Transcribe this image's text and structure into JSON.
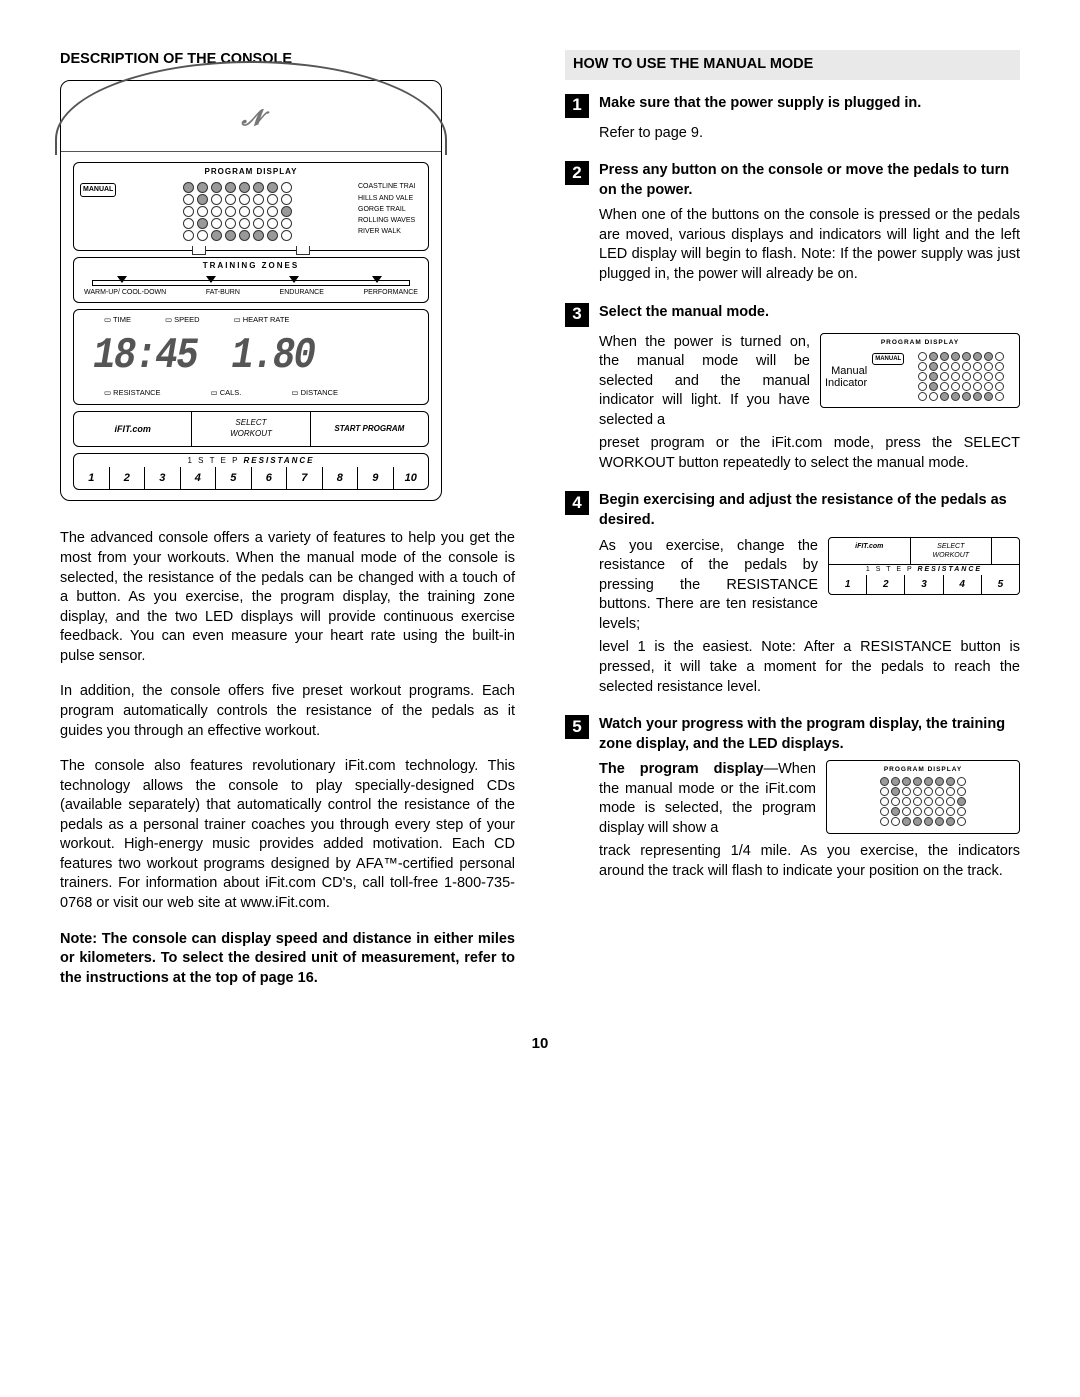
{
  "page_number": "10",
  "left": {
    "header": "DESCRIPTION OF THE CONSOLE",
    "console": {
      "program_display_label": "PROGRAM DISPLAY",
      "manual_label": "MANUAL",
      "courses": [
        "COASTLINE TRAI",
        "HILLS AND VALE",
        "GORGE TRAIL",
        "ROLLING WAVES",
        "RIVER WALK"
      ],
      "training_zones_label": "TRAINING ZONES",
      "tz_items": [
        "WARM-UP/ COOL-DOWN",
        "FAT-BURN",
        "ENDURANCE",
        "PERFORMANCE"
      ],
      "lcd_top": [
        "TIME",
        "SPEED",
        "HEART RATE"
      ],
      "lcd_left_value": "18:45",
      "lcd_right_value": "1.80",
      "lcd_bot": [
        "RESISTANCE",
        "CALS.",
        "DISTANCE"
      ],
      "buttons": {
        "ifit": "iFIT.com",
        "select1": "SELECT",
        "select2": "WORKOUT",
        "start1": "START",
        "start2": " PROGRAM"
      },
      "resistance_label_pre": "1 S T E P ",
      "resistance_label": "RESISTANCE",
      "resistance_nums": [
        "1",
        "2",
        "3",
        "4",
        "5",
        "6",
        "7",
        "8",
        "9",
        "10"
      ]
    },
    "p1": "The advanced console offers a variety of features to help you get the most from your workouts. When the manual mode of the console is selected, the resistance of the pedals can be changed with a touch of a button. As you exercise, the program display, the training zone display, and the two LED displays will provide continuous exercise feedback. You can even measure your heart rate using the built-in pulse sensor.",
    "p2": "In addition, the console offers five preset workout programs. Each program automatically controls the resistance of the pedals as it guides you through an effective workout.",
    "p3": "The console also features revolutionary iFit.com technology. This technology allows the console to play specially-designed CDs (available separately) that automatically control the resistance of the pedals as a personal trainer coaches you through every step of your workout. High-energy music provides added motivation. Each CD features two workout programs designed by AFA™-certified personal trainers. For information about iFit.com CD's, call toll-free 1-800-735-0768 or visit our web site at www.iFit.com.",
    "note": "Note: The console can display speed and distance in either miles or kilometers. To select the desired unit of measurement, refer to the instructions at the top of page 16."
  },
  "right": {
    "header": "HOW TO USE THE MANUAL MODE",
    "steps": {
      "s1": {
        "n": "1",
        "title": "Make sure that the power supply is plugged in.",
        "body": "Refer to page 9."
      },
      "s2": {
        "n": "2",
        "title": "Press any button on the console or move the pedals to turn on the power.",
        "body": "When one of the buttons on the console is pressed or the pedals are moved, various displays and indicators will light and the left LED display will begin to flash. Note: If the power supply was just plugged in, the power will already be on."
      },
      "s3": {
        "n": "3",
        "title": "Select the manual mode.",
        "body_a": "When the power is turned on, the manual mode will be selected and the manual indicator will light. If you have selected a",
        "body_b": "preset program or the iFit.com mode, press the SELECT WORKOUT button repeatedly to select the manual mode.",
        "fig": {
          "pd": "PROGRAM DISPLAY",
          "manual": "MANUAL",
          "label1": "Manual",
          "label2": "Indicator"
        }
      },
      "s4": {
        "n": "4",
        "title": "Begin exercising and adjust the resistance of the pedals as desired.",
        "body_a": "As you exercise, change the resistance of the pedals by pressing the RESISTANCE buttons. There are ten resistance levels;",
        "body_b": "level 1 is the easiest. Note: After a RESISTANCE button is pressed, it will take a moment for the pedals to reach the selected resistance level.",
        "fig": {
          "ifit": "iFIT.com",
          "select1": "SELECT",
          "select2": "WORKOUT",
          "res_pre": "1 S T E P ",
          "res": "RESISTANCE",
          "nums": [
            "1",
            "2",
            "3",
            "4",
            "5"
          ]
        }
      },
      "s5": {
        "n": "5",
        "title": "Watch your progress with the program display, the training zone display, and the LED displays.",
        "lead_bold": "The program display",
        "body_a": "—When the manual mode or the iFit.com mode is selected, the program display will show a",
        "body_b": "track representing 1/4 mile. As you exercise, the indicators around the track will flash to indicate your position on the track.",
        "fig": {
          "pd": "PROGRAM DISPLAY"
        }
      }
    }
  }
}
